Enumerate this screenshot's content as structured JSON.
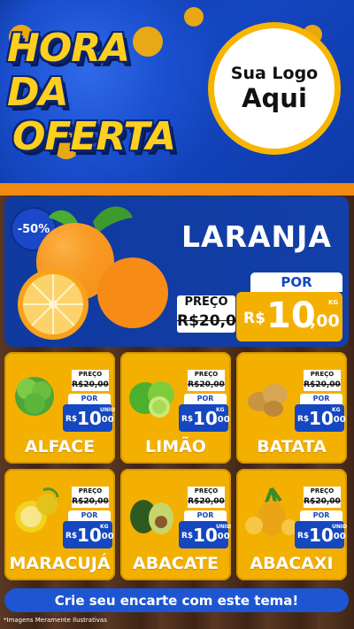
{
  "header": {
    "title_line1": "HORA DA",
    "title_line2": "OFERTA",
    "logo_line1": "Sua Logo",
    "logo_line2": "Aqui"
  },
  "hero": {
    "discount_badge": "-50%",
    "name": "LARANJA",
    "preco_label": "PREÇO",
    "old_price": "R$20,00",
    "por_label": "POR",
    "currency": "R$",
    "price_int": "10",
    "price_cents": ",00",
    "unit": "KG"
  },
  "products": [
    {
      "name": "ALFACE",
      "preco_label": "PREÇO",
      "old_price": "R$20,00",
      "por_label": "POR",
      "currency": "R$",
      "price_int": "10",
      "price_cents": ",00",
      "unit": "UNID"
    },
    {
      "name": "LIMÃO",
      "preco_label": "PREÇO",
      "old_price": "R$20,00",
      "por_label": "POR",
      "currency": "R$",
      "price_int": "10",
      "price_cents": ",00",
      "unit": "KG"
    },
    {
      "name": "BATATA",
      "preco_label": "PREÇO",
      "old_price": "R$20,00",
      "por_label": "POR",
      "currency": "R$",
      "price_int": "10",
      "price_cents": ",00",
      "unit": "KG"
    },
    {
      "name": "MARACUJÁ",
      "preco_label": "PREÇO",
      "old_price": "R$20,00",
      "por_label": "POR",
      "currency": "R$",
      "price_int": "10",
      "price_cents": ",00",
      "unit": "KG"
    },
    {
      "name": "ABACATE",
      "preco_label": "PREÇO",
      "old_price": "R$20,00",
      "por_label": "POR",
      "currency": "R$",
      "price_int": "10",
      "price_cents": ",00",
      "unit": "UNID"
    },
    {
      "name": "ABACAXI",
      "preco_label": "PREÇO",
      "old_price": "R$20,00",
      "por_label": "POR",
      "currency": "R$",
      "price_int": "10",
      "price_cents": ",00",
      "unit": "UNID"
    }
  ],
  "cta": "Crie seu encarte com este tema!",
  "disclaimer": "*Imagens Meramente Ilustrativas",
  "colors": {
    "brand_blue": "#1547c0",
    "card_yellow": "#f4b000",
    "accent_orange": "#f08a12",
    "title_yellow": "#ffcf1f"
  }
}
